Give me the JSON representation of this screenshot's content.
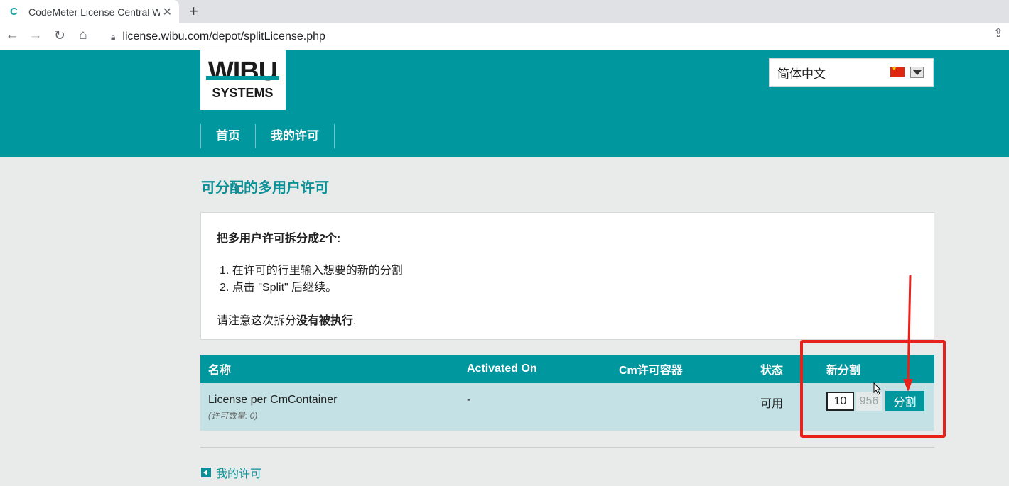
{
  "browser": {
    "tab_title": "CodeMeter License Central We",
    "new_tab_symbol": "+",
    "url": "license.wibu.com/depot/splitLicense.php"
  },
  "header": {
    "logo_top": "WIBU",
    "logo_bottom": "SYSTEMS",
    "language": "简体中文",
    "nav": [
      "首页",
      "我的许可"
    ]
  },
  "page": {
    "title": "可分配的多用户许可",
    "info": {
      "heading": "把多用户许可拆分成2个:",
      "steps": [
        "1. 在许可的行里输入想要的新的分割",
        "2. 点击 \"Split\" 后继续。"
      ],
      "note_prefix": "请注意这次拆分",
      "note_bold": "没有被执行",
      "note_suffix": "."
    }
  },
  "table": {
    "headers": [
      "名称",
      "Activated On",
      "Cm许可容器",
      "状态",
      "新分割"
    ],
    "rows": [
      {
        "name": "License per CmContainer",
        "sub": "(许可数量: 0)",
        "activated_on": "-",
        "container": "",
        "status": "可用",
        "split_value": "10",
        "remaining": "956",
        "split_button": "分割"
      }
    ]
  },
  "footer": {
    "back_link": "我的许可"
  },
  "colors": {
    "brand_teal": "#00979e",
    "row_bg": "#c4e2e5",
    "highlight_red": "#e8221b"
  }
}
